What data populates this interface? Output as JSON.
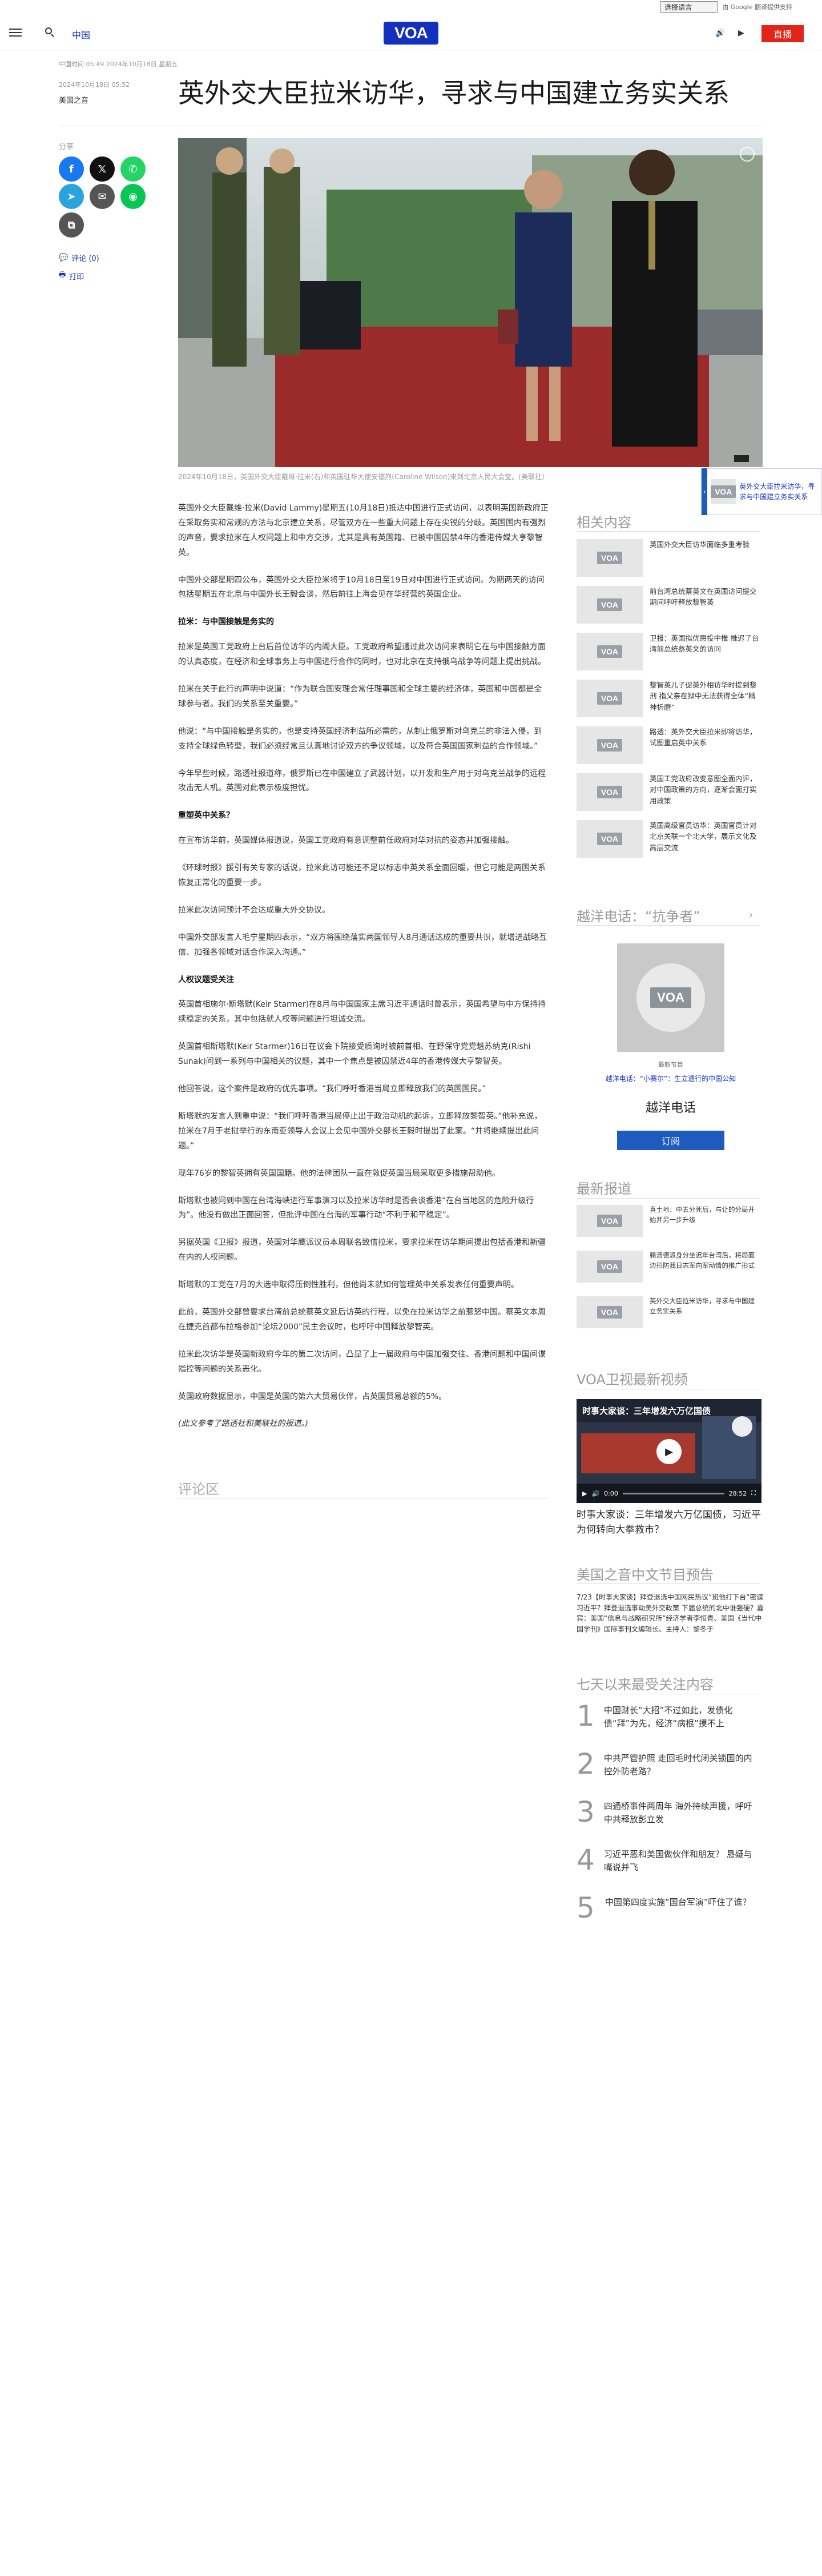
{
  "translate": {
    "select_label": "选择语言",
    "powered_by": "由 Google 翻译提供支持"
  },
  "header": {
    "section": "中国",
    "logo": "VOA",
    "live_label": "直播"
  },
  "article": {
    "dateline": "中国时间 05:49 2024年10月18日 星期五",
    "pubdate": "2024年10月18日 05:52",
    "author": "美国之音",
    "title": "英外交大臣拉米访华，寻求与中国建立务实关系",
    "caption": "2024年10月18日，英国外交大臣戴维·拉米(右)和英国驻华大使安德烈(Caroline Wilson)来到北京人民大会堂。(美联社)",
    "paragraphs": [
      {
        "kind": "p",
        "text": "英国外交大臣戴维·拉米(David Lammy)星期五(10月18日)抵达中国进行正式访问，以表明英国新政府正在采取务实和常规的方法与北京建立关系，尽管双方在一些重大问题上存在尖锐的分歧。英国国内有强烈的声音，要求拉米在人权问题上和中方交涉，尤其是具有英国籍、已被中国囚禁4年的香港传媒大亨黎智英。"
      },
      {
        "kind": "p",
        "text": "中国外交部星期四公布，英国外交大臣拉米将于10月18日至19日对中国进行正式访问。为期两天的访问包括星期五在北京与中国外长王毅会谈，然后前往上海会见在华经营的英国企业。"
      },
      {
        "kind": "h",
        "text": "拉米：与中国接触是务实的"
      },
      {
        "kind": "p",
        "text": "拉米是英国工党政府上台后首位访华的内阁大臣。工党政府希望通过此次访问来表明它在与中国接触方面的认真态度，在经济和全球事务上与中国进行合作的同时，也对北京在支持俄乌战争等问题上提出挑战。"
      },
      {
        "kind": "p",
        "text": "拉米在关于此行的声明中说道：“作为联合国安理会常任理事国和全球主要的经济体，英国和中国都是全球参与者。我们的关系至关重要。”"
      },
      {
        "kind": "p",
        "text": "他说：“与中国接触是务实的，也是支持英国经济利益所必需的，从制止俄罗斯对乌克兰的非法入侵，到支持全球绿色转型，我们必须经常且认真地讨论双方的争议领域，以及符合英国国家利益的合作领域。”"
      },
      {
        "kind": "p",
        "text": "今年早些时候，路透社报道称，俄罗斯已在中国建立了武器计划，以开发和生产用于对乌克兰战争的远程攻击无人机。英国对此表示极度担忧。"
      },
      {
        "kind": "h",
        "text": "重塑英中关系？"
      },
      {
        "kind": "p",
        "text": "在宣布访华前，英国媒体报道说，英国工党政府有意调整前任政府对华对抗的姿态并加强接触。"
      },
      {
        "kind": "p",
        "text": "《环球时报》援引有关专家的话说，拉米此访可能还不足以标志中英关系全面回暖，但它可能是两国关系恢复正常化的重要一步。"
      },
      {
        "kind": "p",
        "text": "拉米此次访问预计不会达成重大外交协议。"
      },
      {
        "kind": "p",
        "text": "中国外交部发言人毛宁星期四表示，“双方将围绕落实两国领导人8月通话达成的重要共识，就增进战略互信、加强各领域对话合作深入沟通。”"
      },
      {
        "kind": "h",
        "text": "人权议题受关注"
      },
      {
        "kind": "p",
        "text": "英国首相施尔·斯塔默(Keir Starmer)在8月与中国国家主席习近平通话时曾表示，英国希望与中方保持持续稳定的关系，其中包括就人权等问题进行坦诚交流。"
      },
      {
        "kind": "p",
        "text": "英国首相斯塔默(Keir Starmer)16日在议会下院接受质询时被前首相、在野保守党党魁苏纳克(Rishi Sunak)问到一系列与中国相关的议题，其中一个焦点是被囚禁近4年的香港传媒大亨黎智英。"
      },
      {
        "kind": "p",
        "text": "他回答说，这个案件是政府的优先事项。“我们呼吁香港当局立即释放我们的英国国民。”"
      },
      {
        "kind": "p",
        "text": "斯塔默的发言人则重申说：“我们呼吁香港当局停止出于政治动机的起诉，立即释放黎智英。”他补充说，拉米在7月于老挝举行的东南亚领导人会议上会见中国外交部长王毅时提出了此案。“并将继续提出此问题。”"
      },
      {
        "kind": "p",
        "text": "现年76岁的黎智英拥有英国国籍。他的法律团队一直在敦促英国当局采取更多措施帮助他。"
      },
      {
        "kind": "p",
        "text": "斯塔默也被问到中国在台湾海峡进行军事演习以及拉米访华时是否会谈香港“在台当地区的危险升级行为”。他没有做出正面回答，但批评中国在台海的军事行动“不利于和平稳定”。"
      },
      {
        "kind": "p",
        "text": "另据英国《卫报》报道，英国对华鹰派议员本周联名致信拉米，要求拉米在访华期间提出包括香港和新疆在内的人权问题。"
      },
      {
        "kind": "p",
        "text": "斯塔默的工党在7月的大选中取得压倒性胜利，但他尚未就如何管理英中关系发表任何重要声明。"
      },
      {
        "kind": "p",
        "text": "此前，英国外交部曾要求台湾前总统蔡英文延后访英的行程，以免在拉米访华之前惹怒中国。蔡英文本周在捷克首都布拉格参加“论坛2000”民主会议时，也呼吁中国释放黎智英。"
      },
      {
        "kind": "p",
        "text": "拉米此次访华是英国新政府今年的第二次访问，凸显了上一届政府与中国加强交往、香港问题和中国间谍指控等问题的关系恶化。"
      },
      {
        "kind": "p",
        "text": "英国政府数据显示，中国是英国的第六大贸易伙伴，占英国贸易总额的5%。"
      },
      {
        "kind": "credit",
        "text": "(此文参考了路透社和美联社的报道。)"
      }
    ],
    "comments_title": "评论区"
  },
  "share": {
    "label": "分享",
    "comments_link": "评论 (0)",
    "print_link": "打印"
  },
  "sidebar": {
    "related_title": "相关内容",
    "related": [
      "英国外交大臣访华面临多重考验",
      "前台湾总统蔡英文在英国访问提交期间呼吁释放黎智英",
      "卫报：英国拟优惠投中推 推迟了台湾前总统蔡英文的访问",
      "黎智英儿子促英外相访华时提到黎刑 指父亲在狱中无法获得全体“精神折磨”",
      "路透：英外交大臣拉米即将访华，试图重启英中关系",
      "英国工党政府改变意图全面内评，对中国政策的方向，逐渐会面打实用政策",
      "英国高级官员访华：英国官员计对北京关联一个北大学，展示文化及高层交流"
    ],
    "podcast_title": "越洋电话：“抗争者”",
    "podcast_name": "越洋电话",
    "podcast_label": "最新节目",
    "podcast_episode": "越洋电话：“小赛尔”：生立遗行的中国公知",
    "subscribe_label": "订阅",
    "latest_title": "最新报道",
    "latest": [
      "真土地：中五分死后，与让的分局开始并另一步升级",
      "赖清德派身分坐迟年台湾后，将局面边形防我日志军向军动情的推广形式",
      "英外交大臣拉米访华，寻求与中国建立务实关系"
    ],
    "video_title": "VOA卫视最新视频",
    "video_overlay": "时事大家谈：三年增发六万亿国债",
    "video_time_current": "0:00",
    "video_time_total": "28:52",
    "video_caption": "时事大家谈：三年增发六万亿国债，习近平为何转向大拳救市？",
    "schedule_title": "美国之音中文节目预告",
    "schedule_text": "7/23【时事大家谈】拜登退选中国网民热议“班他打下台”密谋习近平？拜登退选事动美外交政策 下届总统的北中谁强硬？嘉宾：美国“信息与战略研究所”经济学者李恒青、美国《当代中国学刊》国际事刊文编辑长、主持人：黎冬于",
    "popular_title": "七天以来最受关注内容",
    "popular": [
      {
        "num": "1",
        "text": "中国财长“大招”不过如此，发债化债“拜”为先，经济“病根”摸不上"
      },
      {
        "num": "2",
        "text": "中共严管护照 走回毛时代闭关锁国的内控外防老路？"
      },
      {
        "num": "3",
        "text": "四通桥事件两周年 海外持续声援，呼吁中共释放彭立发"
      },
      {
        "num": "4",
        "text": "习近平恶和美国做伙伴和朋友？ 恳疑与嘴说并飞"
      },
      {
        "num": "5",
        "text": "中国第四度实施“国台军演”吓住了谁？"
      }
    ]
  },
  "sticky": {
    "text": "英外交大臣拉米访华，寻求与中国建立务实关系"
  },
  "colors": {
    "brand": "#1330bf",
    "live": "#e1251b",
    "subscribe": "#1e5bbd"
  }
}
